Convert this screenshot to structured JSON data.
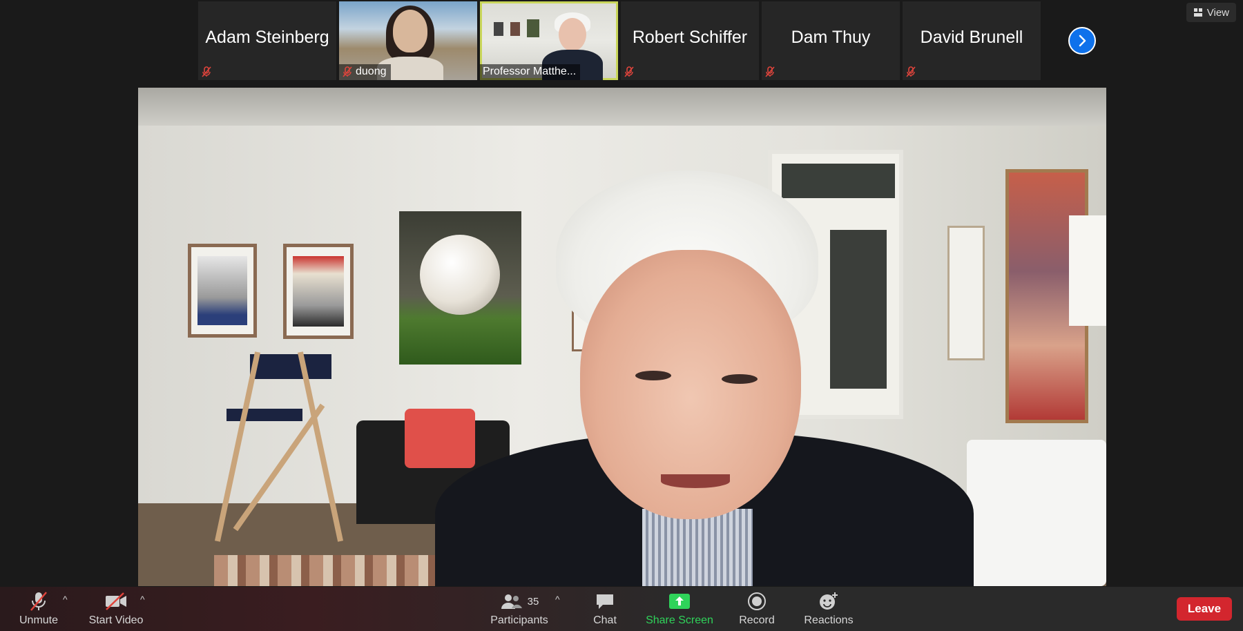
{
  "participants_strip": [
    {
      "name": "Adam Steinberg",
      "video": false,
      "muted": true
    },
    {
      "name": "duong",
      "video": true,
      "muted": true
    },
    {
      "name": "Professor Matthe...",
      "video": true,
      "muted": false,
      "active_speaker": true
    },
    {
      "name": "Robert Schiffer",
      "video": false,
      "muted": true
    },
    {
      "name": "Dam Thuy",
      "video": false,
      "muted": true
    },
    {
      "name": "David Brunell",
      "video": false,
      "muted": true
    }
  ],
  "view_button": {
    "label": "View",
    "icon": "grid-icon"
  },
  "toolbar": {
    "unmute_label": "Unmute",
    "start_video_label": "Start Video",
    "participants_label": "Participants",
    "participants_count": "35",
    "chat_label": "Chat",
    "share_screen_label": "Share Screen",
    "record_label": "Record",
    "reactions_label": "Reactions",
    "leave_label": "Leave"
  },
  "colors": {
    "accent_blue": "#0e71eb",
    "share_green": "#2fd35a",
    "leave_red": "#d3262e",
    "active_speaker_border": "#c9d65a",
    "muted_red": "#e0443c"
  }
}
